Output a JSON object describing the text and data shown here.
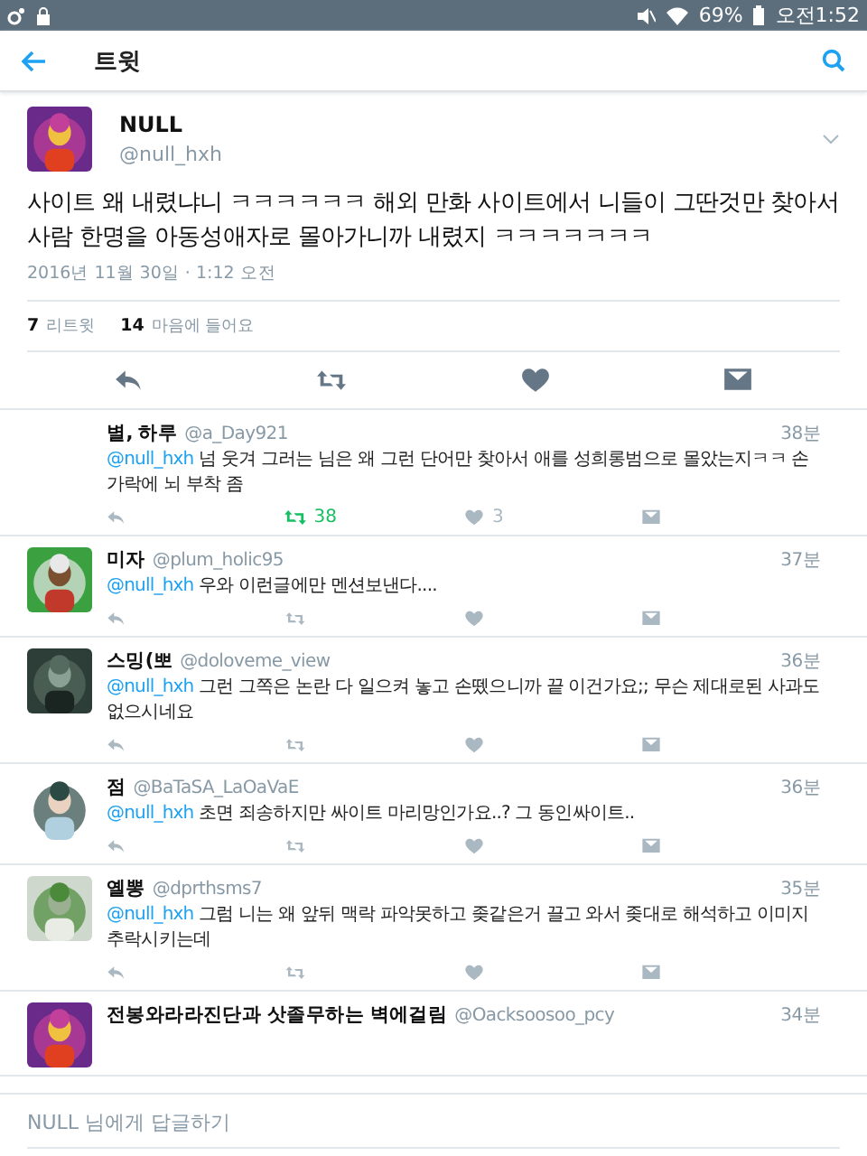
{
  "status_bar": {
    "battery": "69%",
    "time": "오전1:52"
  },
  "app_bar": {
    "title": "트윗"
  },
  "tweet": {
    "name": "NULL",
    "handle": "@null_hxh",
    "text": "사이트 왜 내렸냐니 ㅋㅋㅋㅋㅋㅋ 해외 만화 사이트에서 니들이 그딴것만 찾아서 사람 한명을 아동성애자로 몰아가니까 내렸지 ㅋㅋㅋㅋㅋㅋㅋ",
    "date": "2016년 11월 30일 · 1:12 오전",
    "retweets": {
      "count": "7",
      "label": "리트윗"
    },
    "likes": {
      "count": "14",
      "label": "마음에 들어요"
    }
  },
  "replies": [
    {
      "avatar": false,
      "name": "별, 하루",
      "handle": "@a_Day921",
      "time": "38분",
      "mention": "@null_hxh",
      "text": "넘 웃겨 그러는 님은 왜 그런 단어만 찾아서 애를 성희롱범으로 몰았는지ㅋㅋ 손가락에 뇌 부착 좀",
      "retweeted": true,
      "retweet_count": "38",
      "like_count": "3"
    },
    {
      "avatar": true,
      "name": "미자",
      "handle": "@plum_holic95",
      "time": "37분",
      "mention": "@null_hxh",
      "text": "우와 이런글에만 멘션보낸다....",
      "retweeted": false
    },
    {
      "avatar": true,
      "name": "스밍(뽀",
      "handle": "@doloveme_view",
      "time": "36분",
      "mention": "@null_hxh",
      "text": "그런 그쪽은 논란 다 일으켜 놓고 손뗐으니까 끝 이건가요;;  무슨 제대로된 사과도 없으시네요",
      "retweeted": false
    },
    {
      "avatar": true,
      "name": "점",
      "handle": "@BaTaSA_LaOaVaE",
      "time": "36분",
      "mention": "@null_hxh",
      "text": "초면 죄송하지만 싸이트 마리망인가요..? 그 동인싸이트..",
      "retweeted": false
    },
    {
      "avatar": true,
      "name": "옐뽕",
      "handle": "@dprthsms7",
      "time": "35분",
      "mention": "@null_hxh",
      "text": "그럼 니는 왜 앞뒤 맥락 파악못하고 좆같은거 끌고 와서 좆대로 해석하고 이미지 추락시키는데",
      "retweeted": false
    },
    {
      "avatar": true,
      "name": "전봉와라라진단과 삿졸무하는 벽에걸림",
      "handle": "@Oacksoosoo_pcy",
      "time": "34분"
    }
  ],
  "reply_bar": {
    "placeholder": "NULL 님에게 답글하기"
  }
}
